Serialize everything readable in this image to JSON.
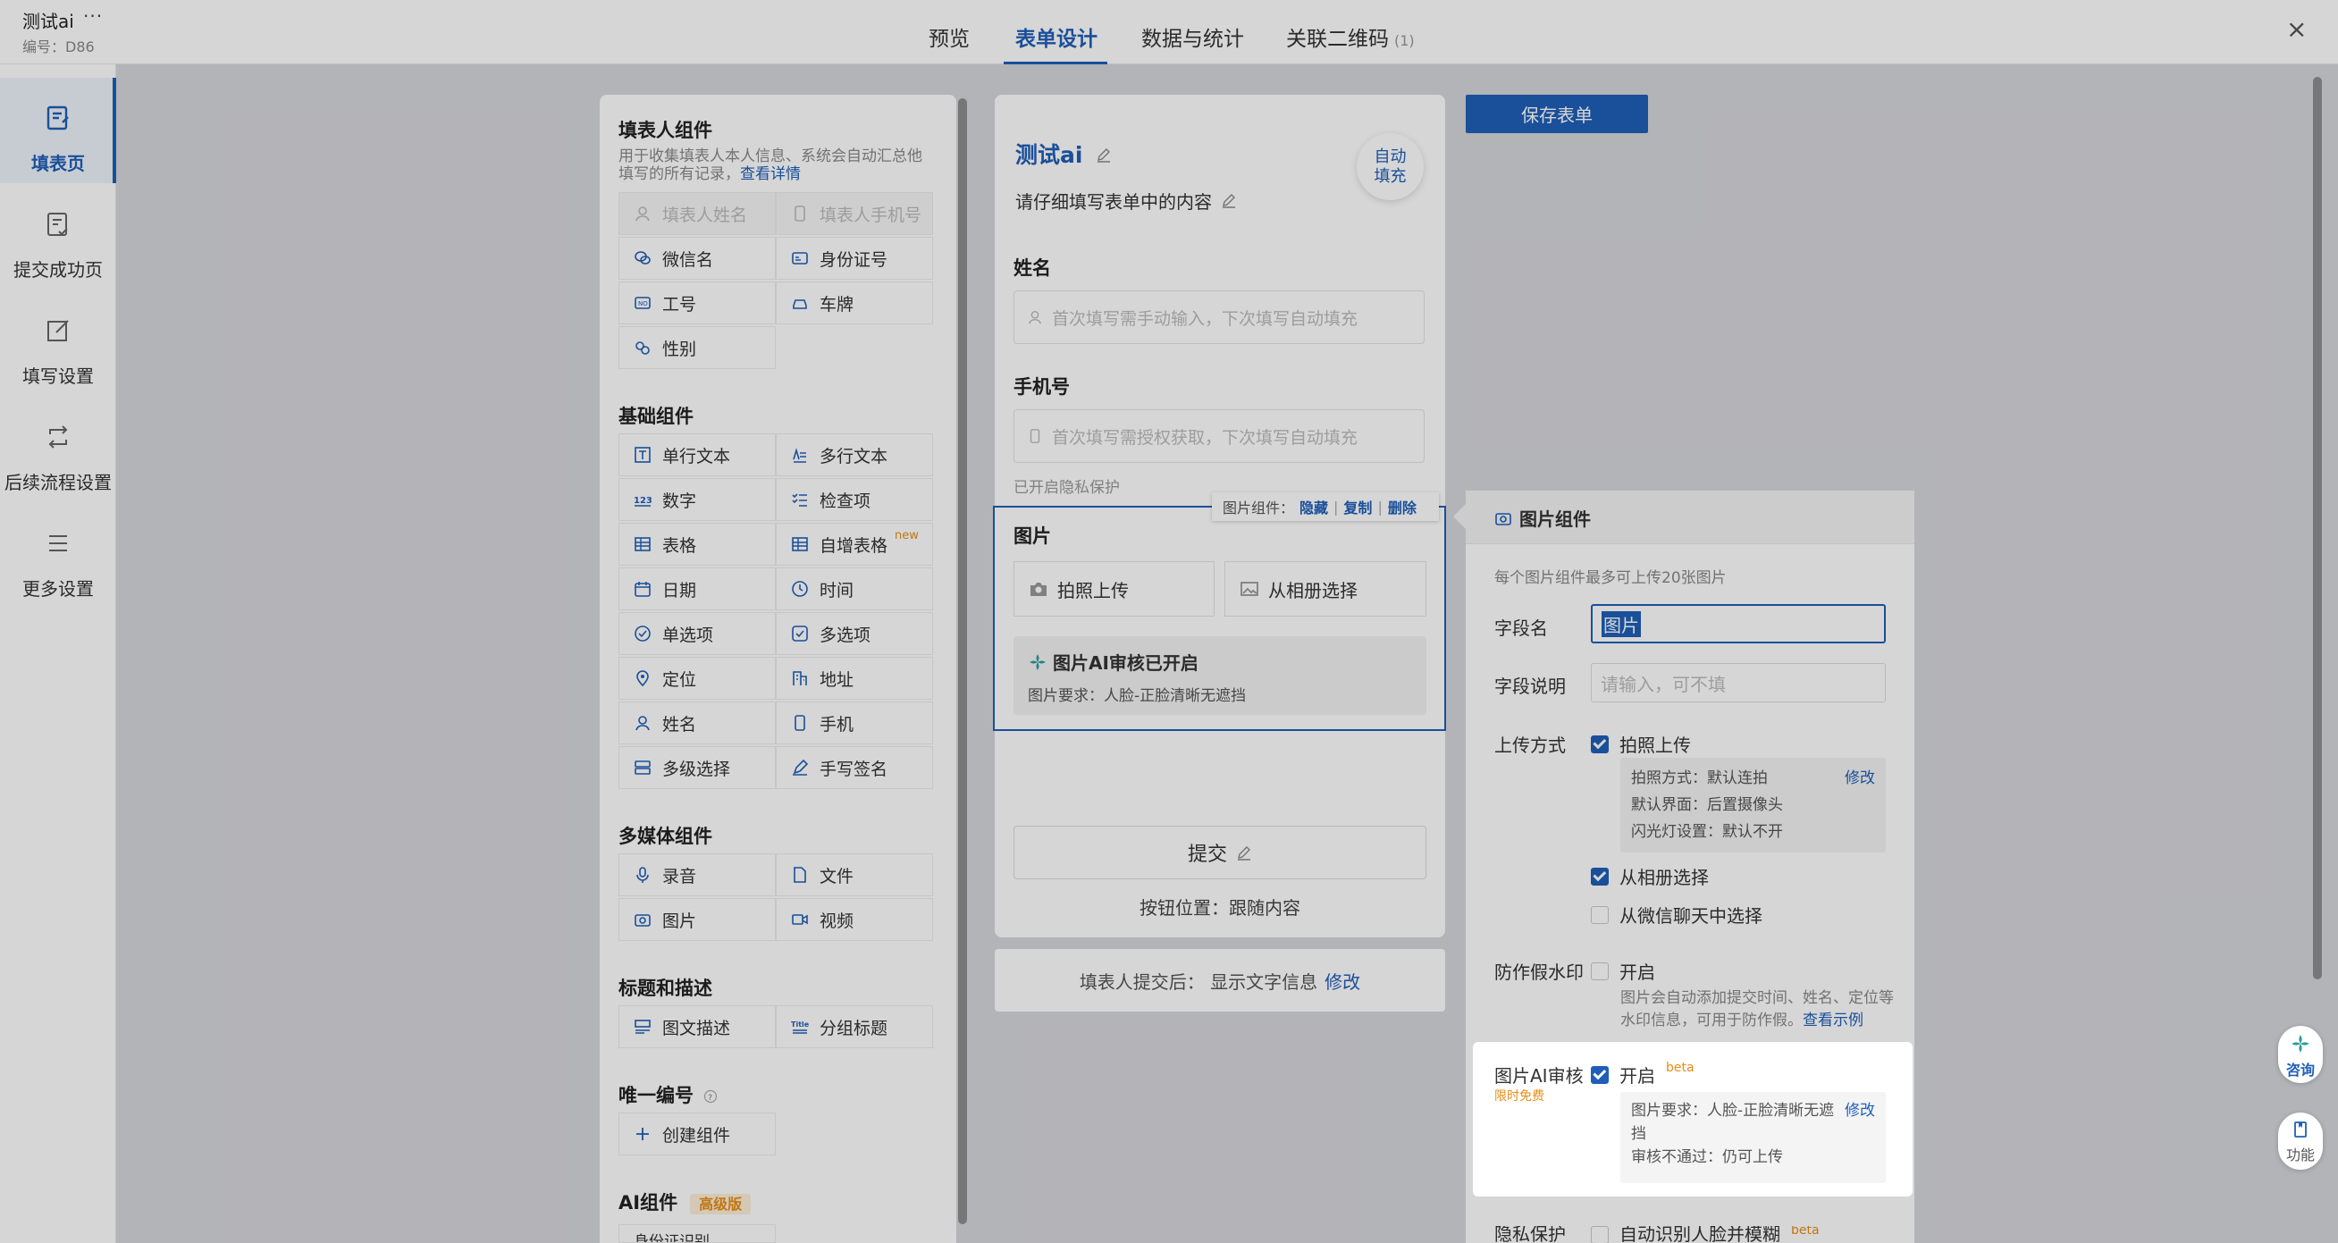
{
  "header": {
    "app_title": "测试ai",
    "more": "···",
    "code": "编号：D86",
    "tabs": [
      {
        "label": "预览"
      },
      {
        "label": "表单设计"
      },
      {
        "label": "数据与统计"
      },
      {
        "label": "关联二维码",
        "count": "(1)"
      }
    ],
    "close": "×"
  },
  "sidebar": {
    "items": [
      {
        "label": "填表页"
      },
      {
        "label": "提交成功页"
      },
      {
        "label": "填写设置"
      },
      {
        "label": "后续流程设置"
      },
      {
        "label": "更多设置"
      }
    ]
  },
  "palette": {
    "filler": {
      "title": "填表人组件",
      "desc1": "用于收集填表人本人信息、系统会自动汇总他",
      "desc2": "填写的所有记录，",
      "link": "查看详情",
      "items": [
        "填表人姓名",
        "填表人手机号",
        "微信名",
        "身份证号",
        "工号",
        "车牌",
        "性别"
      ]
    },
    "basic": {
      "title": "基础组件",
      "items": [
        "单行文本",
        "多行文本",
        "数字",
        "检查项",
        "表格",
        "自增表格",
        "日期",
        "时间",
        "单选项",
        "多选项",
        "定位",
        "地址",
        "姓名",
        "手机",
        "多级选择",
        "手写签名"
      ],
      "new_tag": "new"
    },
    "media": {
      "title": "多媒体组件",
      "items": [
        "录音",
        "文件",
        "图片",
        "视频"
      ]
    },
    "heading": {
      "title": "标题和描述",
      "items": [
        "图文描述",
        "分组标题"
      ]
    },
    "unique": {
      "title": "唯一编号",
      "items": [
        "创建组件"
      ]
    },
    "ai": {
      "title": "AI组件",
      "tag": "高级版",
      "items": [
        "身份证识别"
      ]
    }
  },
  "form": {
    "title": "测试ai",
    "auto_fill": "自动填充",
    "desc": "请仔细填写表单中的内容",
    "name_label": "姓名",
    "name_placeholder": "首次填写需手动输入，下次填写自动填充",
    "phone_label": "手机号",
    "phone_placeholder": "首次填写需授权获取，下次填写自动填充",
    "privacy_tip": "已开启隐私保护",
    "image_label": "图片",
    "toolbar_label": "图片组件：",
    "toolbar_hide": "隐藏",
    "toolbar_copy": "复制",
    "toolbar_delete": "删除",
    "camera_upload": "拍照上传",
    "album_select": "从相册选择",
    "ai_title": "图片AI审核已开启",
    "ai_req": "图片要求：人脸-正脸清晰无遮挡",
    "submit": "提交",
    "btn_position": "按钮位置：跟随内容",
    "after_submit": "填表人提交后： 显示文字信息",
    "after_modify": "修改"
  },
  "save_button": "保存表单",
  "props": {
    "head": "图片组件",
    "limit_tip": "每个图片组件最多可上传20张图片",
    "field_name_label": "字段名",
    "field_name_value": "图片",
    "field_desc_label": "字段说明",
    "field_desc_placeholder": "请输入，可不填",
    "upload_label": "上传方式",
    "camera": "拍照上传",
    "camera_detail": [
      "拍照方式：默认连拍",
      "默认界面：后置摄像头",
      "闪光灯设置：默认不开"
    ],
    "modify": "修改",
    "album": "从相册选择",
    "wechat": "从微信聊天中选择",
    "watermark_label": "防作假水印",
    "watermark_on": "开启",
    "watermark_desc1": "图片会自动添加提交时间、姓名、定位等",
    "watermark_desc2": "水印信息，可用于防作假。",
    "watermark_link": "查看示例",
    "ai_label": "图片AI审核",
    "ai_free": "限时免费",
    "ai_on": "开启",
    "beta": "beta",
    "ai_detail1": "图片要求：人脸-正脸清晰无遮",
    "ai_detail2": "挡",
    "ai_detail3": "审核不通过：仍可上传",
    "privacy_label": "隐私保护",
    "privacy_option": "自动识别人脸并模糊"
  },
  "float": {
    "consult": "咨询",
    "feature": "功能"
  },
  "colors": {
    "accent": "#1f5fb8",
    "orange": "#e88d15"
  }
}
